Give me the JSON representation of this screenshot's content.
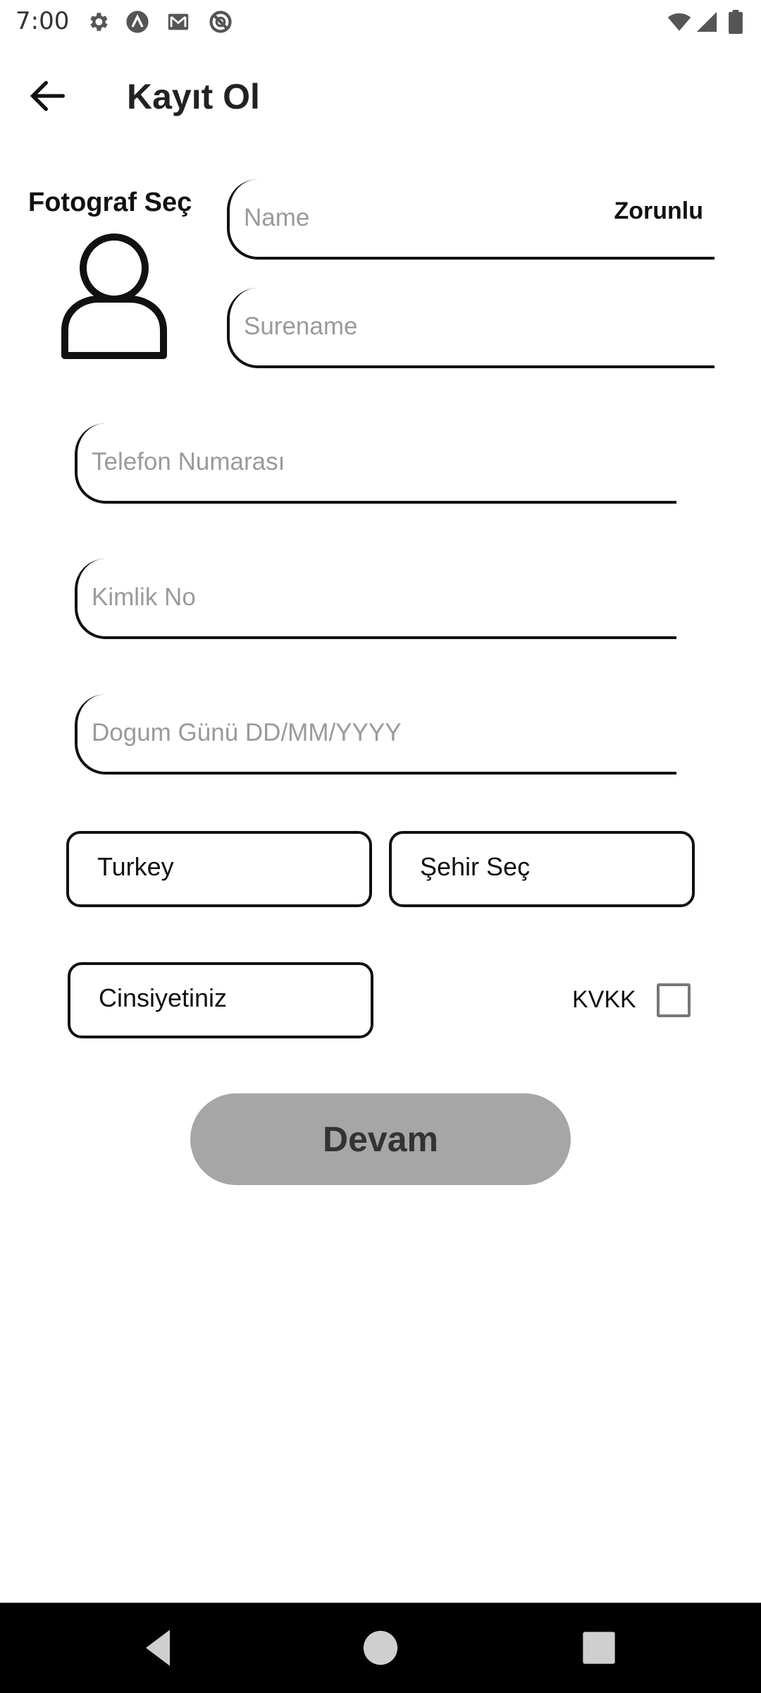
{
  "status_bar": {
    "time": "7:00",
    "left_icons": [
      "gear-icon",
      "app-a-icon",
      "gmail-icon",
      "no-entry-icon"
    ],
    "right_icons": [
      "wifi-icon",
      "signal-icon",
      "battery-icon"
    ]
  },
  "app_bar": {
    "back_icon": "arrow-left-icon",
    "title": "Kayıt Ol"
  },
  "photo": {
    "label": "Fotograf Seç",
    "icon": "person-outline-icon"
  },
  "form": {
    "name": {
      "placeholder": "Name",
      "value": "",
      "required_label": "Zorunlu"
    },
    "surname": {
      "placeholder": "Surename",
      "value": ""
    },
    "phone": {
      "placeholder": "Telefon Numarası",
      "value": ""
    },
    "id_no": {
      "placeholder": "Kimlik No",
      "value": ""
    },
    "birthday": {
      "placeholder": "Dogum Günü DD/MM/YYYY",
      "value": ""
    },
    "country": {
      "value": "Turkey"
    },
    "city": {
      "value": "Şehir Seç"
    },
    "gender": {
      "value": "Cinsiyetiniz"
    },
    "kvkk": {
      "label": "KVKK",
      "checked": false
    }
  },
  "submit": {
    "label": "Devam",
    "color": "#a6a6a6"
  },
  "nav_bar": {
    "icons": [
      "back-triangle-icon",
      "home-circle-icon",
      "recents-square-icon"
    ]
  }
}
